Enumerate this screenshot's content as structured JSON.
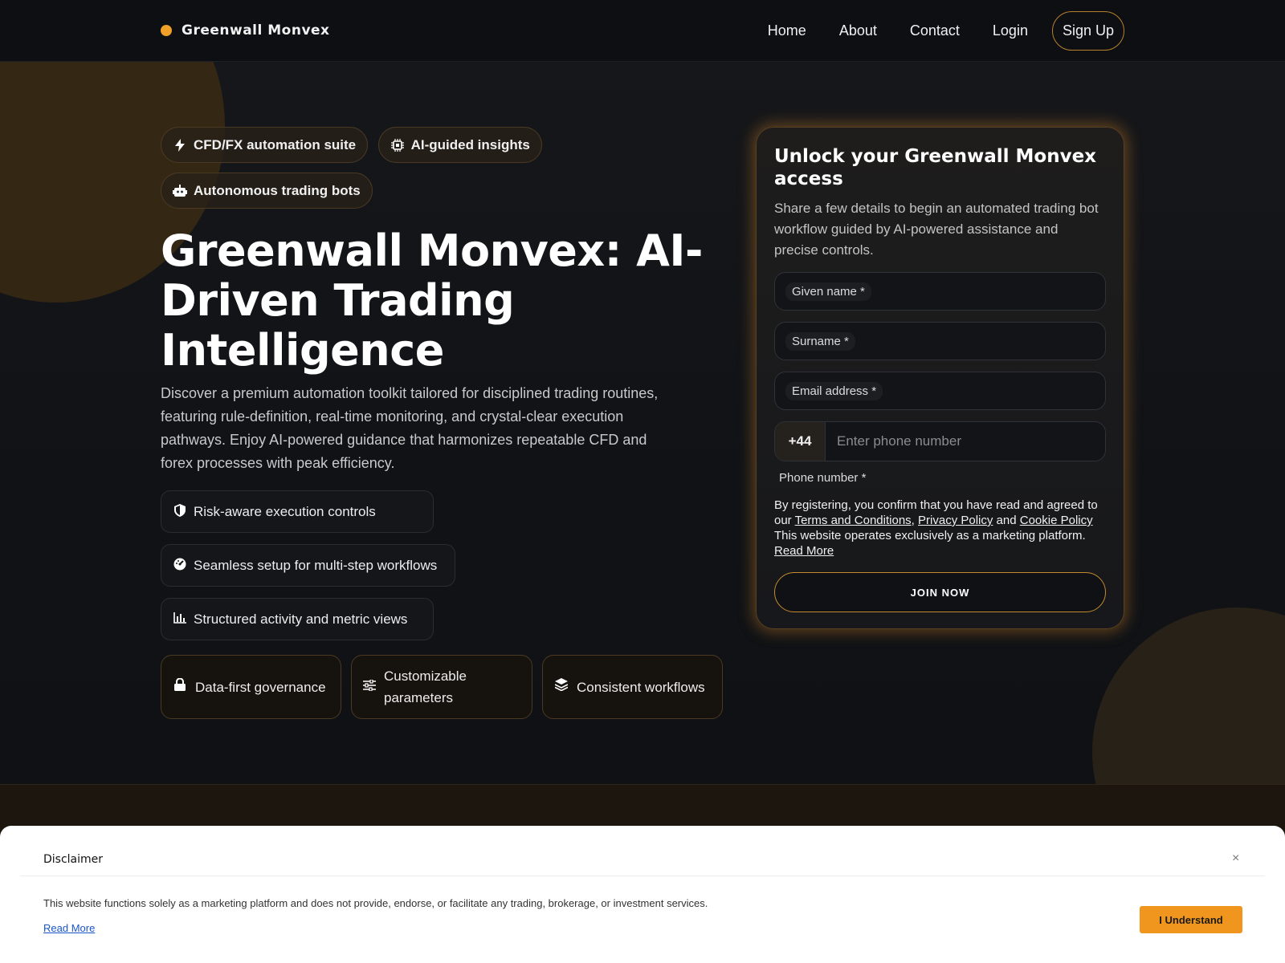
{
  "header": {
    "brand": "Greenwall Monvex",
    "nav": [
      "Home",
      "About",
      "Contact",
      "Login"
    ],
    "signup": "Sign Up"
  },
  "hero": {
    "chips": [
      "CFD/FX automation suite",
      "AI-guided insights",
      "Autonomous trading bots"
    ],
    "headline": "Greenwall Monvex: AI-Driven Trading Intelligence",
    "lead": "Discover a premium automation toolkit tailored for disciplined trading routines, featuring rule-definition, real-time monitoring, and crystal-clear execution pathways. Enjoy AI-powered guidance that harmonizes repeatable CFD and forex processes with peak efficiency.",
    "features": [
      "Risk-aware execution controls",
      "Seamless setup for multi-step workflows",
      "Structured activity and metric views"
    ],
    "cards": [
      "Data-first governance",
      "Customizable parameters",
      "Consistent workflows"
    ]
  },
  "form": {
    "title": "Unlock your Greenwall Monvex access",
    "subtitle": "Share a few details to begin an automated trading bot workflow guided by AI-powered assistance and precise controls.",
    "given_name": "Given name *",
    "surname": "Surname *",
    "email": "Email address *",
    "country_code": "+44",
    "phone_placeholder": "Enter phone number",
    "phone_label": "Phone number *",
    "terms_prefix": "By registering, you confirm that you have read and agreed to our",
    "terms_link": "Terms and Conditions",
    "privacy_link": "Privacy Policy",
    "and": "and",
    "cookie_link": "Cookie Policy",
    "marketing": "This website operates exclusively as a marketing platform.",
    "read_more": "Read More",
    "join": "JOIN NOW"
  },
  "disclaimer": {
    "title": "Disclaimer",
    "close": "×",
    "text": "This website functions solely as a marketing platform and does not provide, endorse, or facilitate any trading, brokerage, or investment services.",
    "read_more": "Read More",
    "button": "I Understand"
  },
  "colors": {
    "accent": "#f0a028",
    "background": "#0f1115",
    "button": "#f0961e"
  }
}
